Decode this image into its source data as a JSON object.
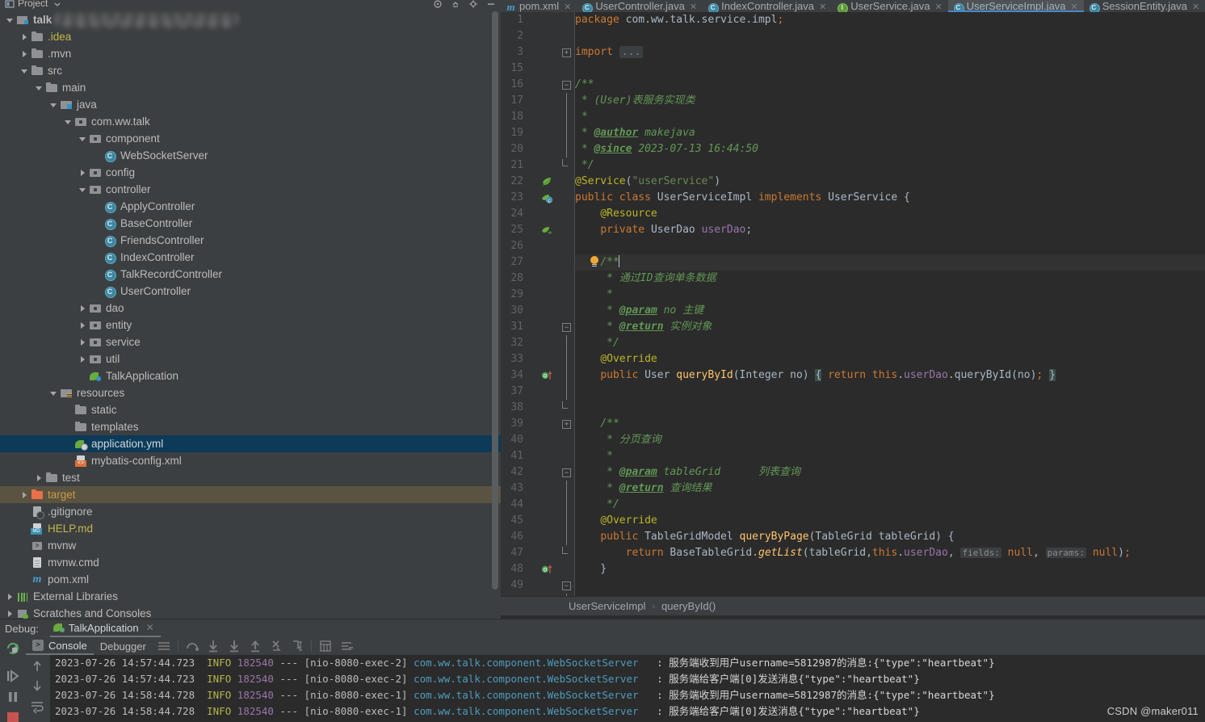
{
  "project_panel": {
    "title": "Project",
    "title_icon": "project-view-icon",
    "dropdown_icon": "chevron-down-icon",
    "toolbar_icons": [
      "locate-icon",
      "collapse-all-icon",
      "settings-gear-icon",
      "hide-icon"
    ],
    "tree": [
      {
        "depth": 0,
        "arrow": "expanded",
        "icon": "module-icon",
        "label": "talk",
        "color": "c-white",
        "bold": true,
        "state": "normal"
      },
      {
        "depth": 1,
        "arrow": "collapsed",
        "icon": "folder-icon",
        "label": ".idea",
        "color": "c-yellow",
        "state": "normal"
      },
      {
        "depth": 1,
        "arrow": "collapsed",
        "icon": "folder-icon",
        "label": ".mvn",
        "color": "c-white",
        "state": "normal"
      },
      {
        "depth": 1,
        "arrow": "expanded",
        "icon": "folder-icon",
        "label": "src",
        "color": "c-white",
        "state": "normal"
      },
      {
        "depth": 2,
        "arrow": "expanded",
        "icon": "folder-icon",
        "label": "main",
        "color": "c-white",
        "state": "normal"
      },
      {
        "depth": 3,
        "arrow": "expanded",
        "icon": "source-root-icon",
        "label": "java",
        "color": "c-white",
        "state": "normal"
      },
      {
        "depth": 4,
        "arrow": "expanded",
        "icon": "package-icon",
        "label": "com.ww.talk",
        "color": "c-white",
        "state": "normal"
      },
      {
        "depth": 5,
        "arrow": "expanded",
        "icon": "package-icon",
        "label": "component",
        "color": "c-white",
        "state": "normal"
      },
      {
        "depth": 6,
        "arrow": "none",
        "icon": "java-class-icon",
        "label": "WebSocketServer",
        "color": "c-white",
        "state": "normal"
      },
      {
        "depth": 5,
        "arrow": "collapsed",
        "icon": "package-icon",
        "label": "config",
        "color": "c-white",
        "state": "normal"
      },
      {
        "depth": 5,
        "arrow": "expanded",
        "icon": "package-icon",
        "label": "controller",
        "color": "c-white",
        "state": "normal"
      },
      {
        "depth": 6,
        "arrow": "none",
        "icon": "java-class-icon",
        "label": "ApplyController",
        "color": "c-white",
        "state": "normal"
      },
      {
        "depth": 6,
        "arrow": "none",
        "icon": "java-class-icon",
        "label": "BaseController",
        "color": "c-white",
        "state": "normal"
      },
      {
        "depth": 6,
        "arrow": "none",
        "icon": "java-class-icon",
        "label": "FriendsController",
        "color": "c-white",
        "state": "normal"
      },
      {
        "depth": 6,
        "arrow": "none",
        "icon": "java-class-icon",
        "label": "IndexController",
        "color": "c-white",
        "state": "normal"
      },
      {
        "depth": 6,
        "arrow": "none",
        "icon": "java-class-icon",
        "label": "TalkRecordController",
        "color": "c-white",
        "state": "normal"
      },
      {
        "depth": 6,
        "arrow": "none",
        "icon": "java-class-icon",
        "label": "UserController",
        "color": "c-white",
        "state": "normal"
      },
      {
        "depth": 5,
        "arrow": "collapsed",
        "icon": "package-icon",
        "label": "dao",
        "color": "c-white",
        "state": "normal"
      },
      {
        "depth": 5,
        "arrow": "collapsed",
        "icon": "package-icon",
        "label": "entity",
        "color": "c-white",
        "state": "normal"
      },
      {
        "depth": 5,
        "arrow": "collapsed",
        "icon": "package-icon",
        "label": "service",
        "color": "c-white",
        "state": "normal"
      },
      {
        "depth": 5,
        "arrow": "collapsed",
        "icon": "package-icon",
        "label": "util",
        "color": "c-white",
        "state": "normal"
      },
      {
        "depth": 5,
        "arrow": "none",
        "icon": "spring-boot-class-icon",
        "label": "TalkApplication",
        "color": "c-white",
        "state": "normal"
      },
      {
        "depth": 3,
        "arrow": "expanded",
        "icon": "resources-root-icon",
        "label": "resources",
        "color": "c-white",
        "state": "normal"
      },
      {
        "depth": 4,
        "arrow": "none",
        "icon": "folder-icon",
        "label": "static",
        "color": "c-white",
        "state": "normal"
      },
      {
        "depth": 4,
        "arrow": "none",
        "icon": "folder-icon",
        "label": "templates",
        "color": "c-white",
        "state": "normal"
      },
      {
        "depth": 4,
        "arrow": "none",
        "icon": "spring-yaml-icon",
        "label": "application.yml",
        "color": "c-white",
        "state": "selected"
      },
      {
        "depth": 4,
        "arrow": "none",
        "icon": "xml-file-icon",
        "label": "mybatis-config.xml",
        "color": "c-white",
        "state": "normal"
      },
      {
        "depth": 2,
        "arrow": "collapsed",
        "icon": "folder-icon",
        "label": "test",
        "color": "c-white",
        "state": "normal"
      },
      {
        "depth": 1,
        "arrow": "collapsed",
        "icon": "excluded-folder-icon",
        "label": "target",
        "color": "c-orange",
        "state": "hovered"
      },
      {
        "depth": 1,
        "arrow": "none",
        "icon": "gitignore-icon",
        "label": ".gitignore",
        "color": "c-white",
        "state": "normal"
      },
      {
        "depth": 1,
        "arrow": "none",
        "icon": "markdown-icon",
        "label": "HELP.md",
        "color": "c-yellow",
        "state": "normal"
      },
      {
        "depth": 1,
        "arrow": "none",
        "icon": "shell-script-icon",
        "label": "mvnw",
        "color": "c-white",
        "state": "normal"
      },
      {
        "depth": 1,
        "arrow": "none",
        "icon": "file-icon",
        "label": "mvnw.cmd",
        "color": "c-white",
        "state": "normal"
      },
      {
        "depth": 1,
        "arrow": "none",
        "icon": "maven-icon",
        "label": "pom.xml",
        "color": "c-white",
        "state": "normal"
      },
      {
        "depth": 0,
        "arrow": "collapsed",
        "icon": "external-libraries-icon",
        "label": "External Libraries",
        "color": "c-white",
        "state": "normal"
      },
      {
        "depth": 0,
        "arrow": "collapsed",
        "icon": "scratches-icon",
        "label": "Scratches and Consoles",
        "color": "c-white",
        "state": "normal"
      }
    ]
  },
  "editor": {
    "tabs": [
      {
        "label": "pom.xml",
        "icon": "maven-icon",
        "active": false,
        "closable": true
      },
      {
        "label": "UserController.java",
        "icon": "java-class-icon",
        "active": false,
        "closable": true
      },
      {
        "label": "IndexController.java",
        "icon": "java-class-icon",
        "active": false,
        "closable": true
      },
      {
        "label": "UserService.java",
        "icon": "java-interface-icon",
        "active": false,
        "closable": true
      },
      {
        "label": "UserServiceImpl.java",
        "icon": "java-class-icon",
        "active": true,
        "closable": true
      },
      {
        "label": "SessionEntity.java",
        "icon": "java-class-icon",
        "active": false,
        "closable": true
      }
    ],
    "breadcrumb": [
      "UserServiceImpl",
      "queryById()"
    ],
    "caret_line": 27,
    "lines": [
      {
        "n": "1",
        "html": "<span class=\"kw\">package</span> com.ww.talk.service.impl<span class=\"kw\">;</span>"
      },
      {
        "n": "2",
        "html": ""
      },
      {
        "n": "3",
        "html": "<span class=\"kw\">import</span> <span class=\"dots\">...</span>"
      },
      {
        "n": "15",
        "html": ""
      },
      {
        "n": "16",
        "html": "<span class=\"cmt\">/**</span>"
      },
      {
        "n": "17",
        "html": "<span class=\"cmt\"> * (User)表服务实现类</span>"
      },
      {
        "n": "18",
        "html": "<span class=\"cmt\"> *</span>"
      },
      {
        "n": "19",
        "html": "<span class=\"cmt\"> * </span><span class=\"cmttag\">@author</span><span class=\"cmt\"> makejava</span>"
      },
      {
        "n": "20",
        "html": "<span class=\"cmt\"> * </span><span class=\"cmttag\">@since</span><span class=\"cmt\"> 2023-07-13 16:44:50</span>"
      },
      {
        "n": "21",
        "html": "<span class=\"cmt\"> */</span>"
      },
      {
        "n": "22",
        "html": "<span class=\"ann\">@Service</span>(<span class=\"str\">\"userService\"</span>)"
      },
      {
        "n": "23",
        "html": "<span class=\"kw\">public class </span>UserServiceImpl <span class=\"kw\">implements </span>UserService {"
      },
      {
        "n": "24",
        "html": "    <span class=\"ann\">@Resource</span>"
      },
      {
        "n": "25",
        "html": "    <span class=\"kw\">private </span>UserDao <span class=\"fld\">userDao</span>;"
      },
      {
        "n": "26",
        "html": ""
      },
      {
        "n": "27",
        "html": "    <span class=\"cmt\">/**</span><span class=\"caret\"></span>"
      },
      {
        "n": "28",
        "html": "     <span class=\"cmt\">* 通过ID查询单条数据</span>"
      },
      {
        "n": "29",
        "html": "     <span class=\"cmt\">*</span>"
      },
      {
        "n": "30",
        "html": "     <span class=\"cmt\">* </span><span class=\"cmttag\">@param</span><span class=\"cmt\"> no 主键</span>"
      },
      {
        "n": "31",
        "html": "     <span class=\"cmt\">* </span><span class=\"cmttag\">@return</span><span class=\"cmt\"> 实例对象</span>"
      },
      {
        "n": "32",
        "html": "     <span class=\"cmt\">*/</span>"
      },
      {
        "n": "33",
        "html": "    <span class=\"ann\">@Override</span>"
      },
      {
        "n": "34",
        "html": "    <span class=\"kw\">public </span>User <span class=\"mth\">queryById</span>(Integer no) <span class=\"brace-hl\">{</span> <span class=\"kw\">return this</span>.<span class=\"fld\">userDao</span>.queryById(no)<span class=\"kw\">;</span> <span class=\"brace-hl\">}</span>"
      },
      {
        "n": "37",
        "html": ""
      },
      {
        "n": "38",
        "html": ""
      },
      {
        "n": "39",
        "html": "    <span class=\"cmt\">/**</span>"
      },
      {
        "n": "40",
        "html": "     <span class=\"cmt\">* 分页查询</span>"
      },
      {
        "n": "41",
        "html": "     <span class=\"cmt\">*</span>"
      },
      {
        "n": "42",
        "html": "     <span class=\"cmt\">* </span><span class=\"cmttag\">@param</span><span class=\"cmt\"> tableGrid      列表查询</span>"
      },
      {
        "n": "43",
        "html": "     <span class=\"cmt\">* </span><span class=\"cmttag\">@return</span><span class=\"cmt\"> 查询结果</span>"
      },
      {
        "n": "44",
        "html": "     <span class=\"cmt\">*/</span>"
      },
      {
        "n": "45",
        "html": "    <span class=\"ann\">@Override</span>"
      },
      {
        "n": "46",
        "html": "    <span class=\"kw\">public </span>TableGridModel <span class=\"mth\">queryByPage</span>(TableGrid tableGrid) {"
      },
      {
        "n": "47",
        "html": "        <span class=\"kw\">return </span>BaseTableGrid.<span class=\"mth\" style=\"font-style:italic\">getList</span>(tableGrid,<span class=\"kw\">this</span>.<span class=\"fld\">userDao</span>, <span class=\"hint\">fields:</span> <span class=\"kw\">null</span>, <span class=\"hint\">params:</span> <span class=\"kw\">null</span>)<span class=\"kw\">;</span>"
      },
      {
        "n": "48",
        "html": "    }"
      },
      {
        "n": "49",
        "html": ""
      }
    ],
    "gutter_marks": [
      {
        "line_index": 10,
        "icon": "spring-bean-icon"
      },
      {
        "line_index": 11,
        "icon": "implemented-class-icon"
      },
      {
        "line_index": 13,
        "icon": "spring-autowired-icon"
      },
      {
        "line_index": 22,
        "icon": "overriding-method-icon"
      },
      {
        "line_index": 34,
        "icon": "overriding-method-icon"
      }
    ],
    "intention_bulb": {
      "line_index": 15,
      "icon": "intention-bulb-icon"
    }
  },
  "debug_panel": {
    "label": "Debug:",
    "run_config": "TalkApplication",
    "run_config_icon": "spring-boot-run-icon",
    "close_icon": "close-icon",
    "tabs": [
      {
        "label": "Console",
        "active": true,
        "icon": "console-icon"
      },
      {
        "label": "Debugger",
        "active": false,
        "icon": ""
      }
    ],
    "toolbar_icons": [
      "show-line-numbers-icon",
      "step-over-icon",
      "step-into-icon",
      "force-step-into-icon",
      "step-out-icon",
      "drop-frame-icon",
      "run-to-cursor-icon",
      "evaluate-expression-icon",
      "mute-breakpoints-icon"
    ],
    "side_icons": [
      "rerun-icon",
      "resume-program-icon",
      "pause-program-icon",
      "stop-icon"
    ],
    "nav_icons": [
      "console-toggle-icon",
      "scroll-up-icon",
      "scroll-down-icon",
      "soft-wrap-icon"
    ],
    "console_lines": [
      {
        "date": "2023-07-26 14:57:44.723",
        "level": "INFO",
        "pid": "182540",
        "thread": "[nio-8080-exec-2]",
        "logger": "com.ww.talk.component.WebSocketServer",
        "msg": ": 服务端收到用户username=5812987的消息:{\"type\":\"heartbeat\"}"
      },
      {
        "date": "2023-07-26 14:57:44.723",
        "level": "INFO",
        "pid": "182540",
        "thread": "[nio-8080-exec-2]",
        "logger": "com.ww.talk.component.WebSocketServer",
        "msg": ": 服务端给客户端[0]发送消息{\"type\":\"heartbeat\"}"
      },
      {
        "date": "2023-07-26 14:58:44.728",
        "level": "INFO",
        "pid": "182540",
        "thread": "[nio-8080-exec-1]",
        "logger": "com.ww.talk.component.WebSocketServer",
        "msg": ": 服务端收到用户username=5812987的消息:{\"type\":\"heartbeat\"}"
      },
      {
        "date": "2023-07-26 14:58:44.728",
        "level": "INFO",
        "pid": "182540",
        "thread": "[nio-8080-exec-1]",
        "logger": "com.ww.talk.component.WebSocketServer",
        "msg": ": 服务端给客户端[0]发送消息{\"type\":\"heartbeat\"}"
      }
    ]
  },
  "watermark": "CSDN @maker011",
  "colors": {
    "ide_bg": "#3c3f41",
    "editor_bg": "#2b2b2b",
    "gutter_bg": "#313335",
    "selection_blue": "#0d3a58",
    "hover_brown": "#5b5341",
    "accent_blue": "#4a88c7",
    "keyword_orange": "#cc7832",
    "string_green": "#6a8759",
    "comment_green": "#629755",
    "annotation_yellow": "#bbb529",
    "field_purple": "#9876aa",
    "method_yellow": "#ffc66d",
    "logger_cyan": "#4e9bbd"
  }
}
